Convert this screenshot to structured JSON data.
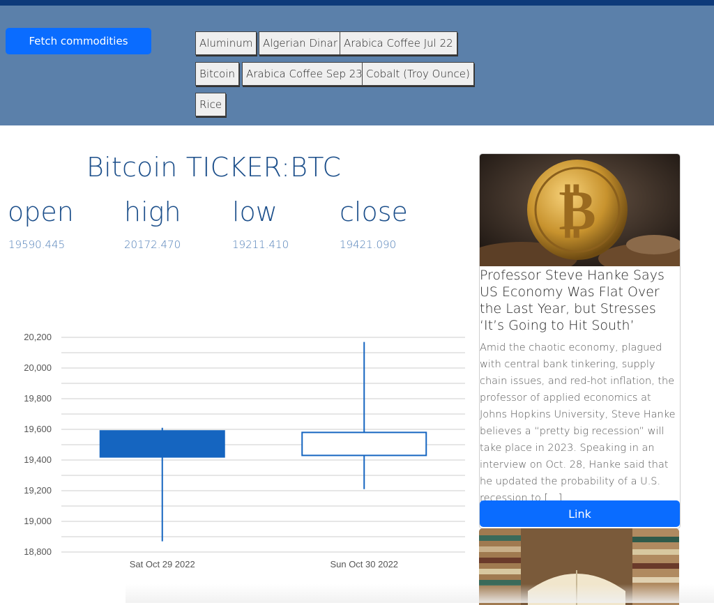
{
  "header": {
    "fetch_button": "Fetch commodities",
    "commodities": [
      "Aluminum",
      "Algerian Dinar",
      "Arabica Coffee Jul 22",
      "Bitcoin",
      "Arabica Coffee Sep 23",
      "Cobalt (Troy Ounce)",
      "Rice"
    ]
  },
  "main": {
    "title": "Bitcoin TICKER:BTC",
    "stats": [
      {
        "label": "open",
        "value": "19590.445"
      },
      {
        "label": "high",
        "value": "20172.470"
      },
      {
        "label": "low",
        "value": "19211.410"
      },
      {
        "label": "close",
        "value": "19421.090"
      }
    ]
  },
  "chart_data": {
    "type": "candlestick",
    "categories": [
      "Sat Oct 29 2022",
      "Sun Oct 30 2022"
    ],
    "candles": [
      {
        "date": "Sat Oct 29 2022",
        "open": 19590,
        "high": 19610,
        "low": 18870,
        "close": 19420,
        "filled": true
      },
      {
        "date": "Sun Oct 30 2022",
        "open": 19430,
        "high": 20170,
        "low": 19210,
        "close": 19580,
        "filled": false
      }
    ],
    "ylim": [
      18800,
      20200
    ],
    "yticks": [
      "18,800",
      "19,000",
      "19,200",
      "19,400",
      "19,600",
      "19,800",
      "20,000",
      "20,200"
    ],
    "grid": true,
    "colors": {
      "candle": "#1565c0",
      "grid": "#cccccc"
    }
  },
  "news": {
    "title": "Professor Steve Hanke Says US Economy Was Flat Over the Last Year, but Stresses ‘It’s Going to Hit South’",
    "text": "Amid the chaotic economy, plagued with central bank tinkering, supply chain issues, and red-hot inflation, the professor of applied economics at Johns Hopkins University, Steve Hanke believes a “pretty big recession” will take place in 2023. Speaking in an interview on Oct. 28, Hanke said that he updated the probability of a U.S. recession to […]",
    "link_label": "Link"
  },
  "colors": {
    "header_bg": "#5b80aa",
    "accent": "#0a6cff",
    "title": "#1b4e8a"
  }
}
